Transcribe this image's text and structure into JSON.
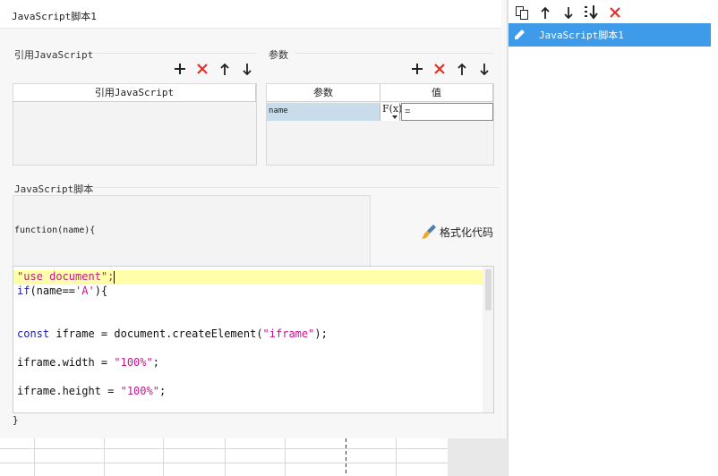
{
  "window": {
    "title": "JavaScript脚本1"
  },
  "references": {
    "section_title": "引用JavaScript",
    "column_header": "引用JavaScript",
    "rows": []
  },
  "params": {
    "section_title": "参数",
    "columns": [
      "参数",
      "值"
    ],
    "rows": [
      {
        "name": "name",
        "fx_label": "F(x)",
        "value": "="
      }
    ]
  },
  "script": {
    "section_title": "JavaScript脚本",
    "function_signature": "function(name){",
    "format_button_label": "格式化代码",
    "closing_brace": "}",
    "code_lines": [
      "\"use document\";",
      "if(name=='A'){",
      "",
      "const iframe = document.createElement(\"iframe\");",
      "",
      "iframe.width = \"100%\";",
      "",
      "iframe.height = \"100%\";"
    ]
  },
  "sidebar": {
    "items": [
      {
        "label": "JavaScript脚本1",
        "selected": true
      }
    ]
  },
  "colors": {
    "accent_blue": "#3d9bea",
    "icon_dark": "#222222",
    "delete_red": "#e0302a",
    "keyword": "#1a1ab0",
    "string": "#c2188a",
    "highlight_line": "#ffffaa",
    "selected_param_cell": "#c8dcea"
  },
  "icons": [
    "add-icon",
    "delete-icon",
    "move-up-icon",
    "move-down-icon",
    "copy-icon",
    "move-bottom-icon",
    "fx-icon",
    "brush-icon",
    "pencil-icon"
  ]
}
